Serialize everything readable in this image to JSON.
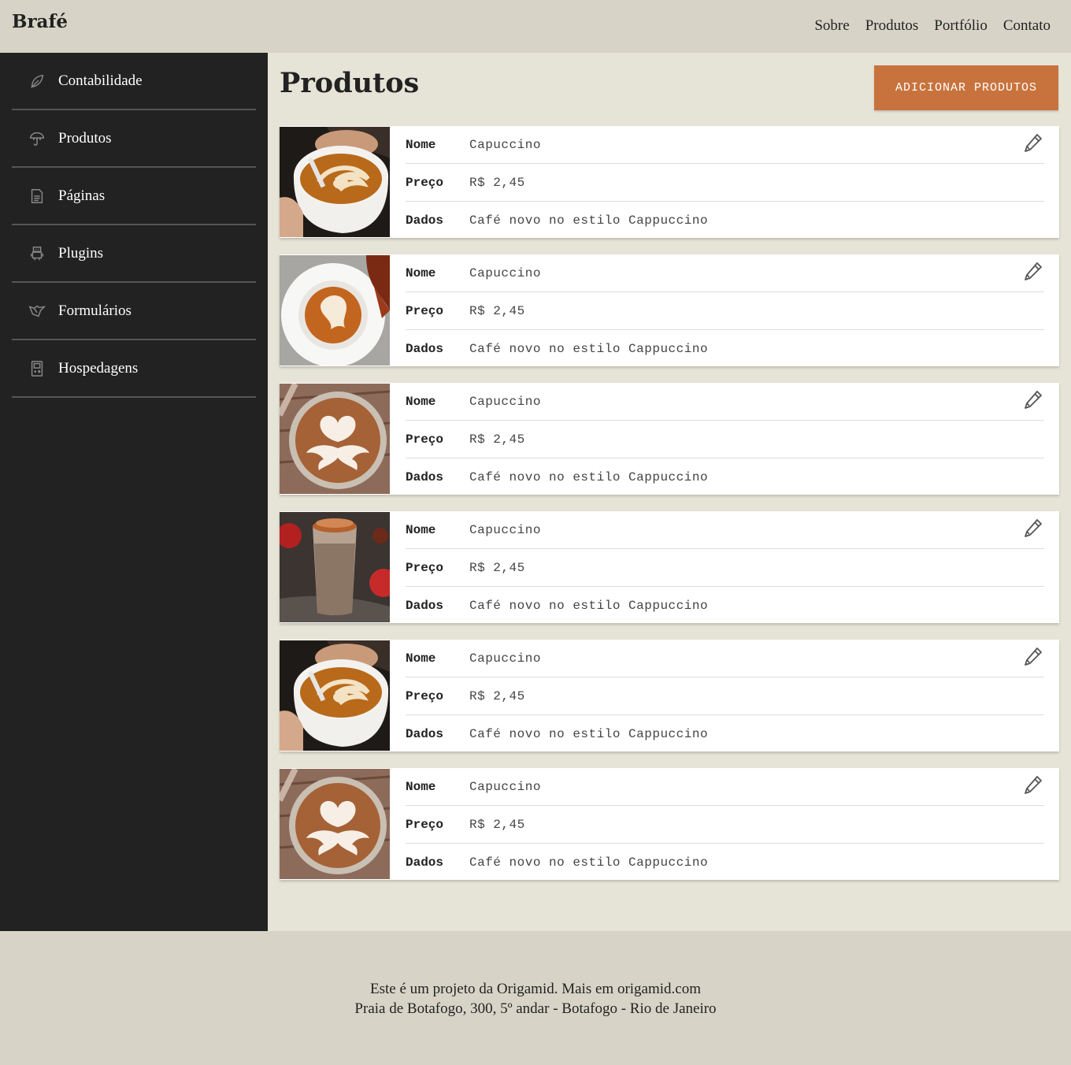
{
  "brand": "Brafé",
  "topnav": [
    "Sobre",
    "Produtos",
    "Portfólio",
    "Contato"
  ],
  "sidebar": {
    "items": [
      {
        "label": "Contabilidade",
        "icon": "leaf-icon"
      },
      {
        "label": "Produtos",
        "icon": "umbrella-icon"
      },
      {
        "label": "Páginas",
        "icon": "document-icon"
      },
      {
        "label": "Plugins",
        "icon": "robot-icon"
      },
      {
        "label": "Formulários",
        "icon": "bird-icon"
      },
      {
        "label": "Hospedagens",
        "icon": "gameboy-icon"
      }
    ]
  },
  "main": {
    "title": "Produtos",
    "add_button": "ADICIONAR PRODUTOS"
  },
  "product_labels": {
    "name": "Nome",
    "price": "Preço",
    "data": "Dados"
  },
  "products": [
    {
      "name": "Capuccino",
      "price": "R$ 2,45",
      "data": "Café novo no estilo Cappuccino",
      "image": "latte-pour-cup"
    },
    {
      "name": "Capuccino",
      "price": "R$ 2,45",
      "data": "Café novo no estilo Cappuccino",
      "image": "latte-saucer-leaves"
    },
    {
      "name": "Capuccino",
      "price": "R$ 2,45",
      "data": "Café novo no estilo Cappuccino",
      "image": "latte-heart-wood"
    },
    {
      "name": "Capuccino",
      "price": "R$ 2,45",
      "data": "Café novo no estilo Cappuccino",
      "image": "latte-glass"
    },
    {
      "name": "Capuccino",
      "price": "R$ 2,45",
      "data": "Café novo no estilo Cappuccino",
      "image": "latte-pour-cup"
    },
    {
      "name": "Capuccino",
      "price": "R$ 2,45",
      "data": "Café novo no estilo Cappuccino",
      "image": "latte-heart-wood"
    }
  ],
  "footer": {
    "line1": "Este é um projeto da Origamid. Mais em origamid.com",
    "line2": "Praia de Botafogo, 300, 5º andar - Botafogo - Rio de Janeiro"
  },
  "colors": {
    "accent": "#c8733d",
    "sidebar": "#222222",
    "header": "#d7d4c7",
    "background": "#e6e3d7"
  }
}
